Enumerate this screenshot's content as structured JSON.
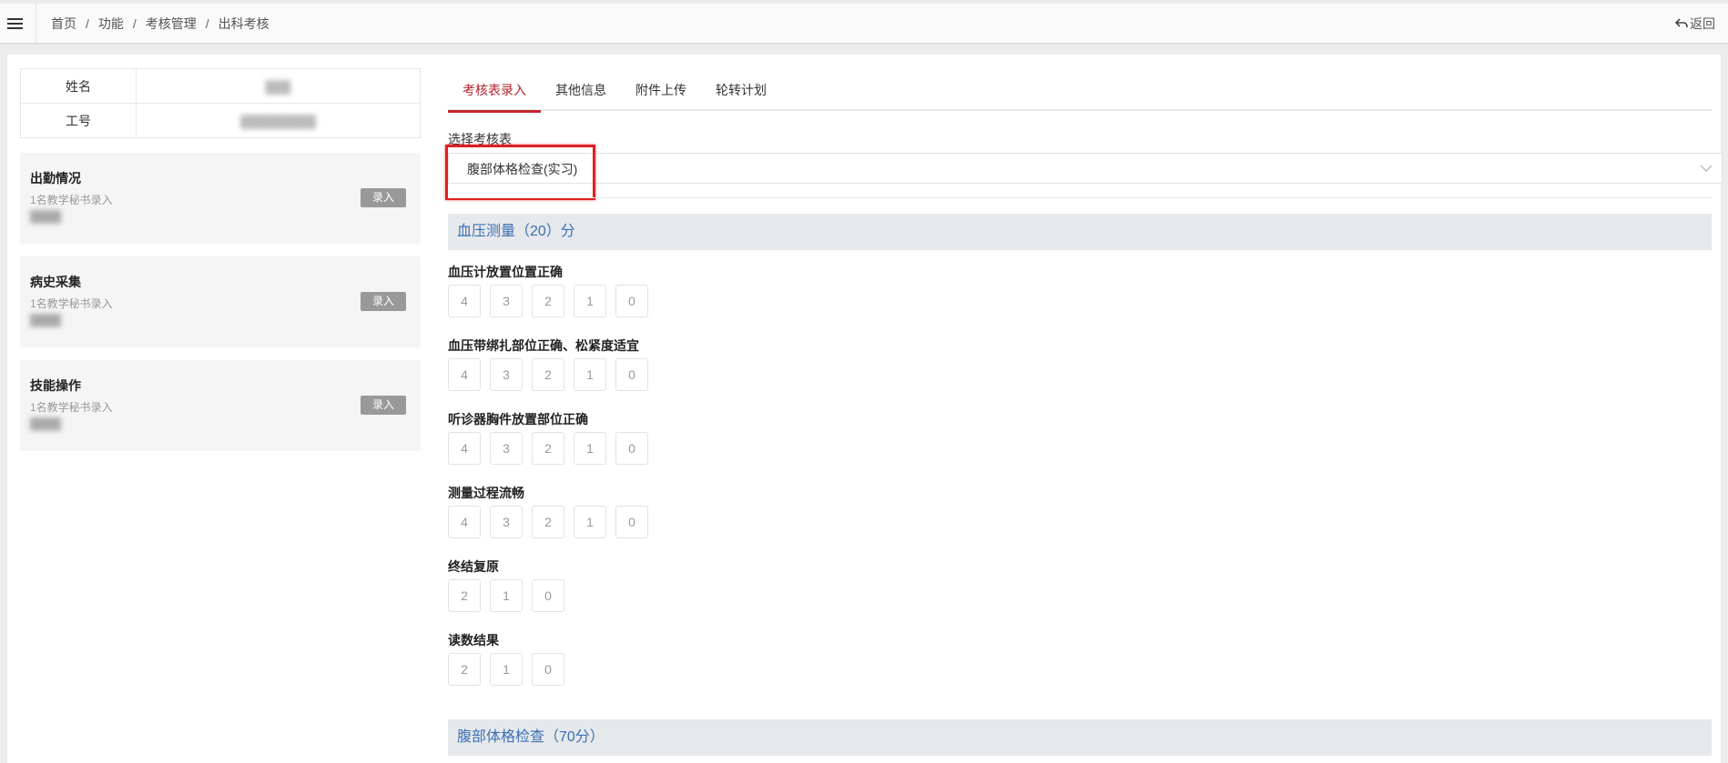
{
  "header": {
    "breadcrumb": [
      "首页",
      "功能",
      "考核管理",
      "出科考核"
    ],
    "separator": "/",
    "back_label": "返回",
    "menu_icon": "hamburger-menu-icon",
    "back_icon": "reply-arrow-icon"
  },
  "student": {
    "name_label": "姓名",
    "name_value": "███",
    "id_label": "工号",
    "id_value": "█████████"
  },
  "cards": [
    {
      "title": "出勤情况",
      "subtitle": "1名教学秘书录入",
      "blur_text": "████",
      "button": "录入"
    },
    {
      "title": "病史采集",
      "subtitle": "1名教学秘书录入",
      "blur_text": "████",
      "button": "录入"
    },
    {
      "title": "技能操作",
      "subtitle": "1名教学秘书录入",
      "blur_text": "████",
      "button": "录入"
    }
  ],
  "tabs": [
    "考核表录入",
    "其他信息",
    "附件上传",
    "轮转计划"
  ],
  "active_tab": "考核表录入",
  "form": {
    "select_label": "选择考核表",
    "select_value": "腹部体格检查(实习)",
    "select_icon": "chevron-down-icon"
  },
  "sections": [
    {
      "title": "血压测量（20）分",
      "items": [
        {
          "label": "血压计放置位置正确",
          "scores": [
            "4",
            "3",
            "2",
            "1",
            "0"
          ]
        },
        {
          "label": "血压带绑扎部位正确、松紧度适宜",
          "scores": [
            "4",
            "3",
            "2",
            "1",
            "0"
          ]
        },
        {
          "label": "听诊器胸件放置部位正确",
          "scores": [
            "4",
            "3",
            "2",
            "1",
            "0"
          ]
        },
        {
          "label": "测量过程流畅",
          "scores": [
            "4",
            "3",
            "2",
            "1",
            "0"
          ]
        },
        {
          "label": "终结复原",
          "scores": [
            "2",
            "1",
            "0"
          ]
        },
        {
          "label": "读数结果",
          "scores": [
            "2",
            "1",
            "0"
          ]
        }
      ]
    },
    {
      "title": "腹部体格检查（70分）",
      "items": []
    }
  ],
  "colors": {
    "accent": "#c1272d",
    "section_title": "#3d6fb4",
    "section_bg": "#e6e9ec",
    "highlight": "#e02020"
  }
}
